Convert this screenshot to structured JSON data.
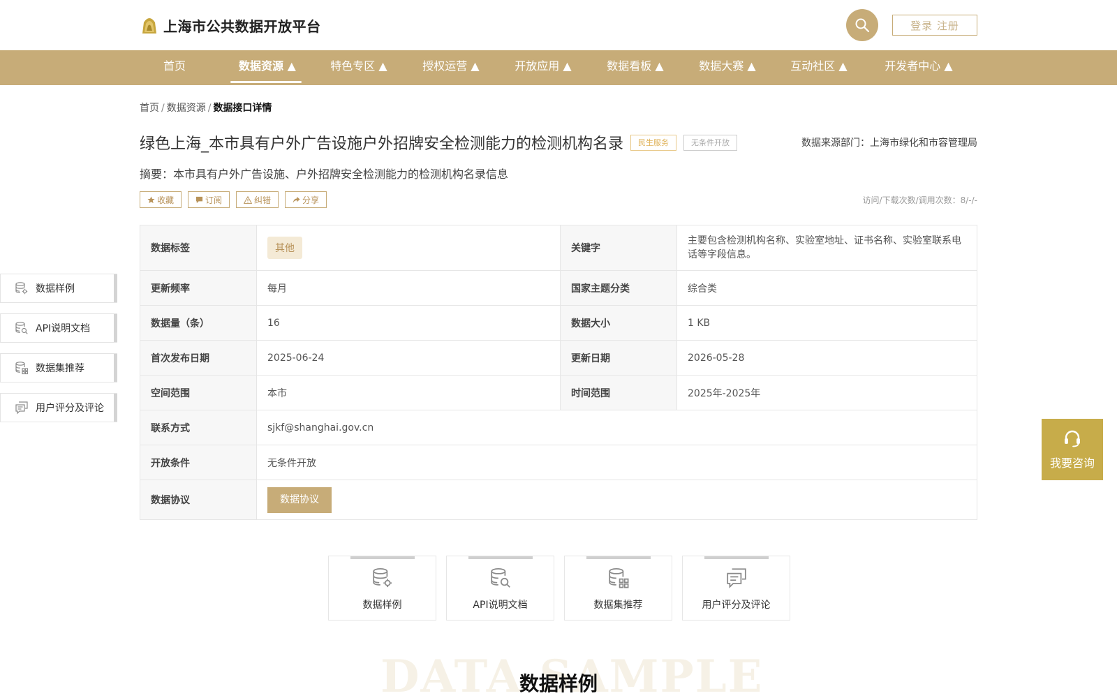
{
  "header": {
    "site_title": "上海市公共数据开放平台",
    "login_label": "登录 注册"
  },
  "nav": [
    {
      "label": "首页"
    },
    {
      "label": "数据资源 ▲"
    },
    {
      "label": "特色专区 ▲"
    },
    {
      "label": "授权运营 ▲"
    },
    {
      "label": "开放应用 ▲"
    },
    {
      "label": "数据看板 ▲"
    },
    {
      "label": "数据大赛 ▲"
    },
    {
      "label": "互动社区 ▲"
    },
    {
      "label": "开发者中心 ▲"
    }
  ],
  "breadcrumb": {
    "home": "首页",
    "level1": "数据资源",
    "current": "数据接口详情",
    "sep": "/"
  },
  "dataset": {
    "title": "绿色上海_本市具有户外广告设施户外招牌安全检测能力的检测机构名录",
    "tag_service": "民生服务",
    "tag_open": "无条件开放",
    "source": "数据来源部门：上海市绿化和市容管理局",
    "summary": "摘要：本市具有户外广告设施、户外招牌安全检测能力的检测机构名录信息",
    "stats": "访问/下载次数/调用次数：8/-/-"
  },
  "actions": {
    "favorite": "收藏",
    "subscribe": "订阅",
    "report": "纠错",
    "share": "分享"
  },
  "info": {
    "tag_k": "数据标签",
    "tag_v": "其他",
    "keyword_k": "关键字",
    "keyword_v": "主要包含检测机构名称、实验室地址、证书名称、实验室联系电话等字段信息。",
    "freq_k": "更新频率",
    "freq_v": "每月",
    "theme_k": "国家主题分类",
    "theme_v": "综合类",
    "count_k": "数据量（条）",
    "count_v": "16",
    "size_k": "数据大小",
    "size_v": "1 KB",
    "first_k": "首次发布日期",
    "first_v": "2025-06-24",
    "update_k": "更新日期",
    "update_v": "2026-05-28",
    "space_k": "空间范围",
    "space_v": "本市",
    "time_k": "时间范围",
    "time_v": "2025年-2025年",
    "contact_k": "联系方式",
    "contact_v": "sjkf@shanghai.gov.cn",
    "open_k": "开放条件",
    "open_v": "无条件开放",
    "agree_k": "数据协议",
    "agree_btn": "数据协议"
  },
  "sidenav": [
    {
      "label": "数据样例",
      "icon": "database-gear-icon"
    },
    {
      "label": "API说明文档",
      "icon": "database-search-icon"
    },
    {
      "label": "数据集推荐",
      "icon": "database-grid-icon"
    },
    {
      "label": "用户评分及评论",
      "icon": "comment-icon"
    }
  ],
  "cards": [
    {
      "label": "数据样例",
      "icon": "database-gear-icon"
    },
    {
      "label": "API说明文档",
      "icon": "database-search-icon"
    },
    {
      "label": "数据集推荐",
      "icon": "database-grid-icon"
    },
    {
      "label": "用户评分及评论",
      "icon": "comment-icon"
    }
  ],
  "section": {
    "watermark": "DATA SAMPLE",
    "title": "数据样例"
  },
  "consult": {
    "label": "我要咨询"
  },
  "colors": {
    "brand": "#c7ac78",
    "consult": "#c7ac4a"
  }
}
